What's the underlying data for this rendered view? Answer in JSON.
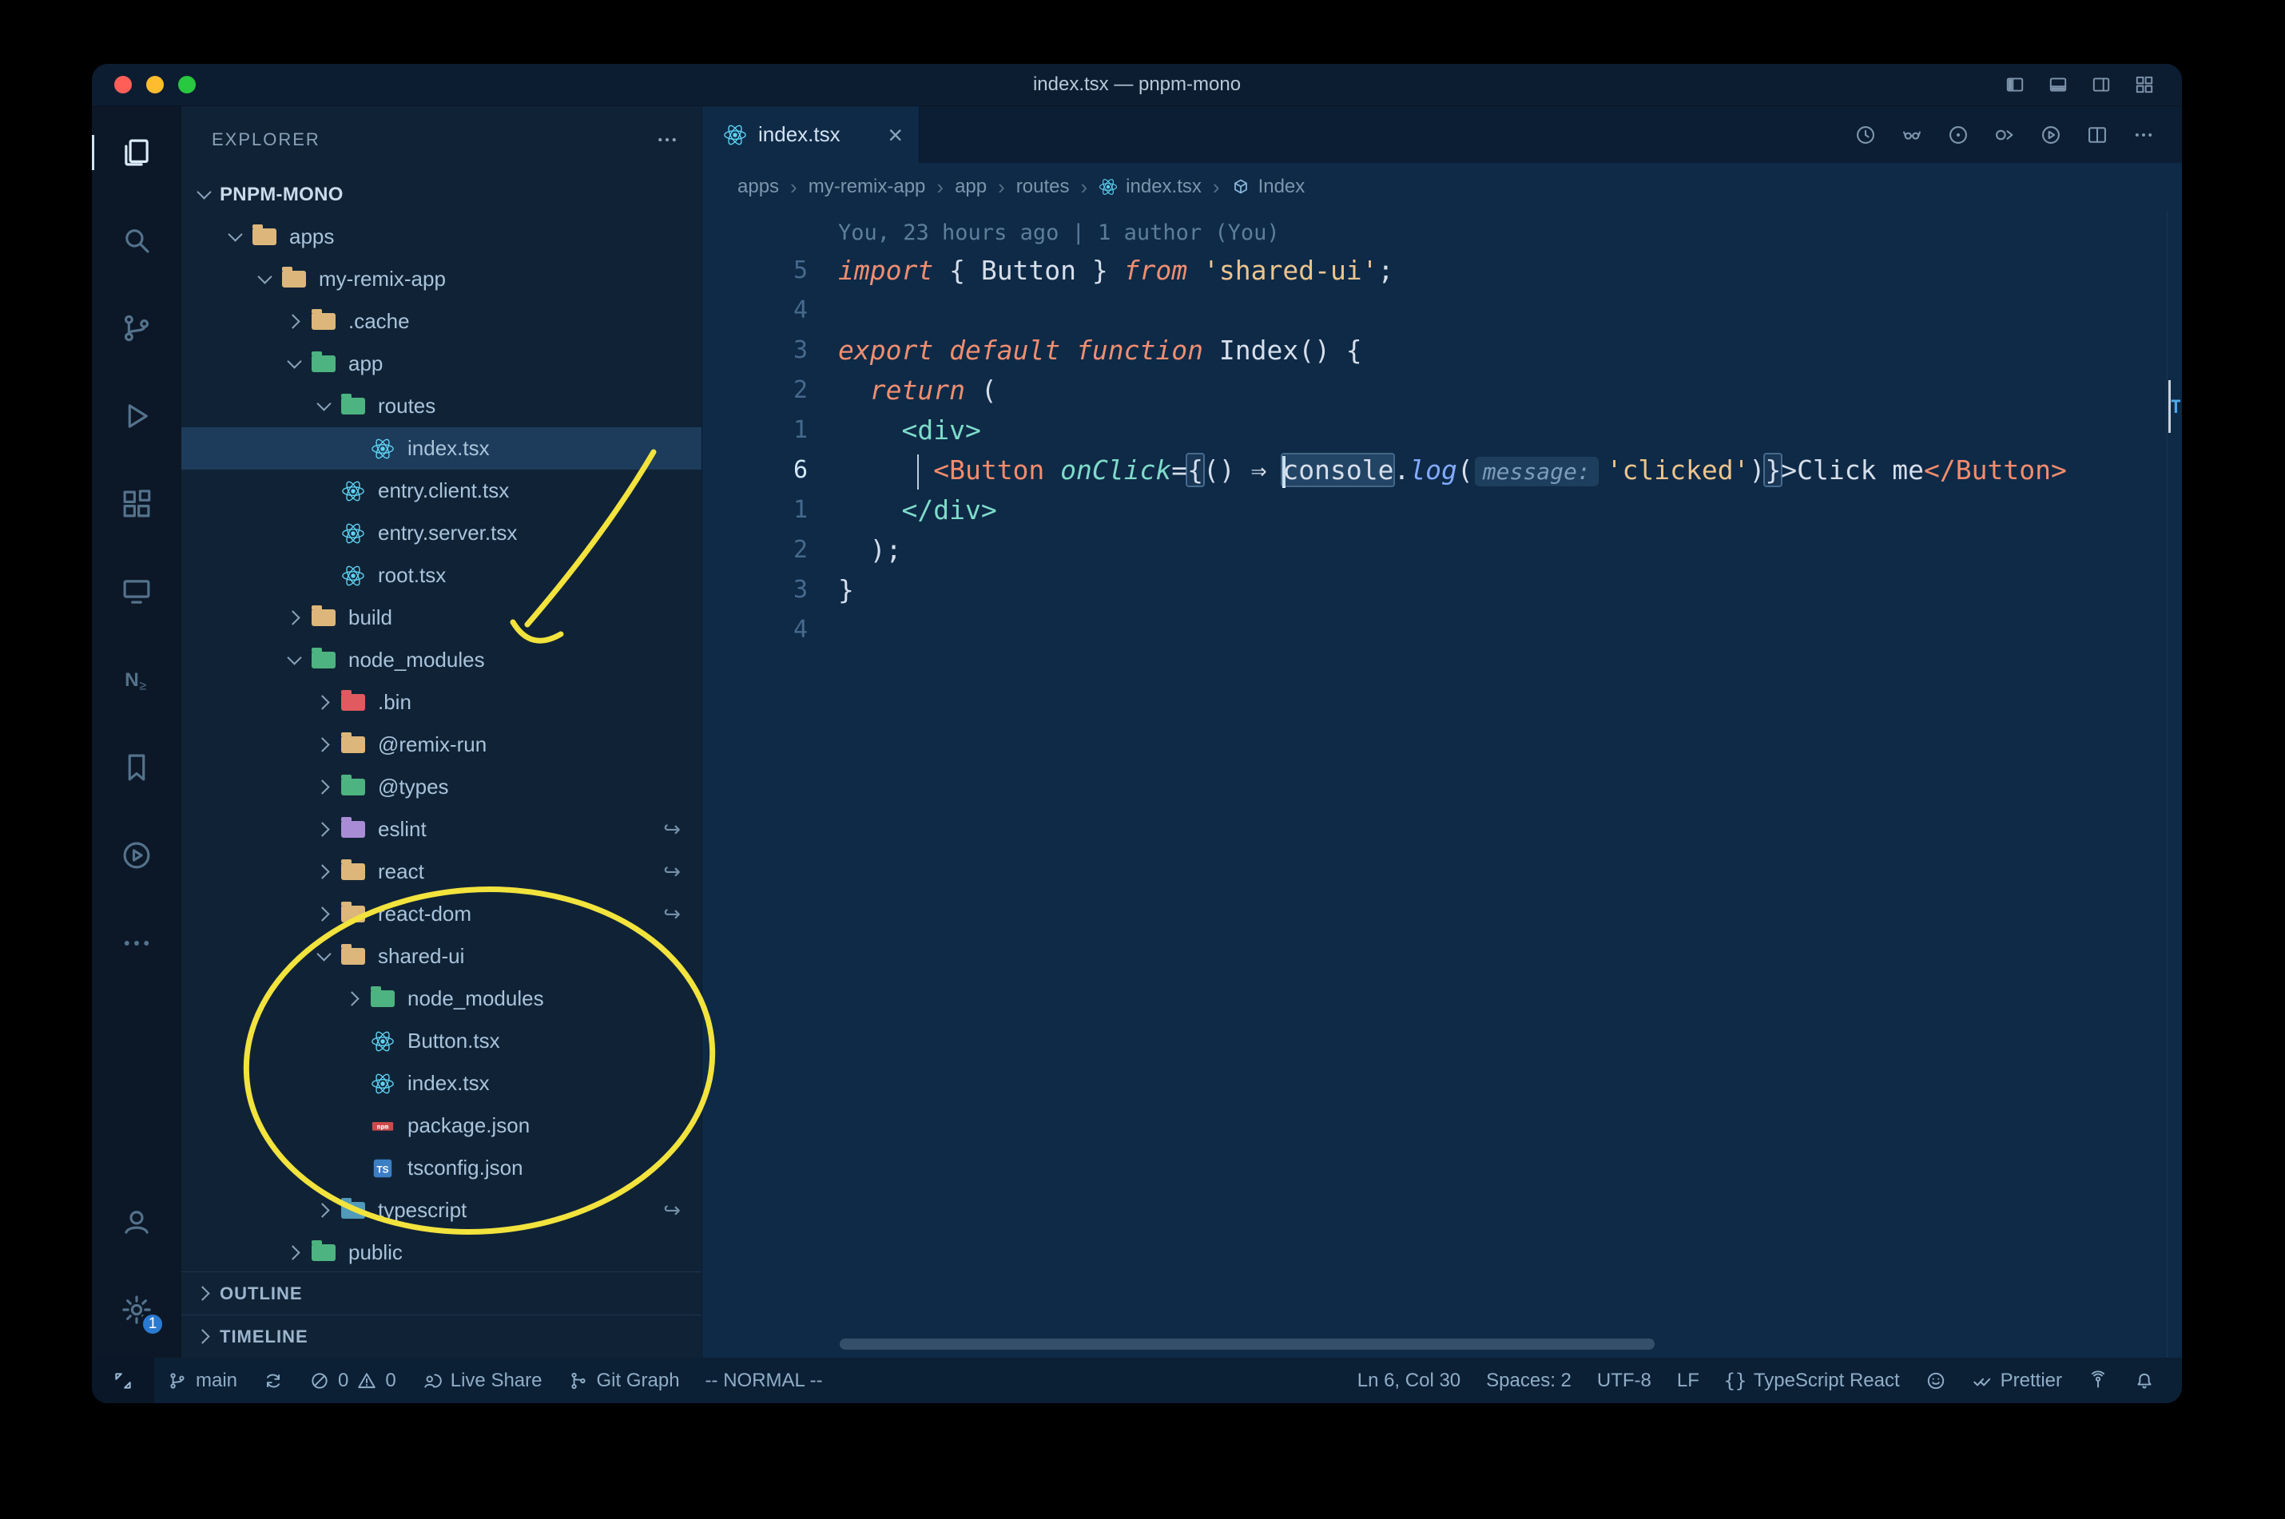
{
  "colors": {
    "annotation": "#f2e33d",
    "traffic_close": "#ff5f57",
    "traffic_minimize": "#febc2e",
    "traffic_zoom": "#28c840",
    "badge": "#2a7ad1"
  },
  "window": {
    "title": "index.tsx — pnpm-mono"
  },
  "titlebar": {
    "layout_icons": [
      "layout-sidebar-left-icon",
      "layout-panel-icon",
      "layout-sidebar-right-icon",
      "customize-layout-icon"
    ]
  },
  "activity_bar": {
    "top": [
      {
        "name": "explorer",
        "icon": "files-icon",
        "active": true
      },
      {
        "name": "search",
        "icon": "search-icon"
      },
      {
        "name": "source-control",
        "icon": "source-control-icon"
      },
      {
        "name": "run-debug",
        "icon": "run-debug-icon"
      },
      {
        "name": "extensions",
        "icon": "extensions-icon"
      },
      {
        "name": "remote-explorer",
        "icon": "remote-explorer-icon"
      },
      {
        "name": "nx-console",
        "icon": "nx-console-icon"
      },
      {
        "name": "bookmarks",
        "icon": "bookmarks-icon"
      },
      {
        "name": "code-runner",
        "icon": "code-runner-icon"
      },
      {
        "name": "additional-views",
        "icon": "ellipsis-icon"
      }
    ],
    "bottom": [
      {
        "name": "accounts",
        "icon": "accounts-icon"
      },
      {
        "name": "settings",
        "icon": "gear-icon",
        "badge": "1"
      }
    ]
  },
  "explorer": {
    "title": "EXPLORER",
    "root": "PNPM-MONO",
    "tree": [
      {
        "label": "apps",
        "depth": 1,
        "chevron": "down",
        "icon": "folder",
        "color": "#dcb67a"
      },
      {
        "label": "my-remix-app",
        "depth": 2,
        "chevron": "down",
        "icon": "folder",
        "color": "#dcb67a"
      },
      {
        "label": ".cache",
        "depth": 3,
        "chevron": "right",
        "icon": "folder",
        "color": "#dcb67a"
      },
      {
        "label": "app",
        "depth": 3,
        "chevron": "down",
        "icon": "folder",
        "color": "#4db380"
      },
      {
        "label": "routes",
        "depth": 4,
        "chevron": "down",
        "icon": "folder",
        "color": "#4db380"
      },
      {
        "label": "index.tsx",
        "depth": 5,
        "chevron": "none",
        "icon": "react",
        "selected": true
      },
      {
        "label": "entry.client.tsx",
        "depth": 4,
        "chevron": "none",
        "icon": "react"
      },
      {
        "label": "entry.server.tsx",
        "depth": 4,
        "chevron": "none",
        "icon": "react"
      },
      {
        "label": "root.tsx",
        "depth": 4,
        "chevron": "none",
        "icon": "react"
      },
      {
        "label": "build",
        "depth": 3,
        "chevron": "right",
        "icon": "folder",
        "color": "#dcb67a"
      },
      {
        "label": "node_modules",
        "depth": 3,
        "chevron": "down",
        "icon": "folder",
        "color": "#4db380"
      },
      {
        "label": ".bin",
        "depth": 4,
        "chevron": "right",
        "icon": "folder",
        "color": "#e05a5f"
      },
      {
        "label": "@remix-run",
        "depth": 4,
        "chevron": "right",
        "icon": "folder",
        "color": "#dcb67a"
      },
      {
        "label": "@types",
        "depth": 4,
        "chevron": "right",
        "icon": "folder",
        "color": "#4db380"
      },
      {
        "label": "eslint",
        "depth": 4,
        "chevron": "right",
        "icon": "folder",
        "color": "#a98cd6",
        "symlink": true
      },
      {
        "label": "react",
        "depth": 4,
        "chevron": "right",
        "icon": "folder",
        "color": "#dcb67a",
        "symlink": true
      },
      {
        "label": "react-dom",
        "depth": 4,
        "chevron": "right",
        "icon": "folder",
        "color": "#dcb67a",
        "symlink": true
      },
      {
        "label": "shared-ui",
        "depth": 4,
        "chevron": "down",
        "icon": "folder",
        "color": "#dcb67a"
      },
      {
        "label": "node_modules",
        "depth": 5,
        "chevron": "right",
        "icon": "folder",
        "color": "#4db380"
      },
      {
        "label": "Button.tsx",
        "depth": 5,
        "chevron": "none",
        "icon": "react"
      },
      {
        "label": "index.tsx",
        "depth": 5,
        "chevron": "none",
        "icon": "react"
      },
      {
        "label": "package.json",
        "depth": 5,
        "chevron": "none",
        "icon": "npm"
      },
      {
        "label": "tsconfig.json",
        "depth": 5,
        "chevron": "none",
        "icon": "ts"
      },
      {
        "label": "typescript",
        "depth": 4,
        "chevron": "right",
        "icon": "folder",
        "color": "#519aba",
        "symlink": true
      },
      {
        "label": "public",
        "depth": 3,
        "chevron": "right",
        "icon": "folder",
        "color": "#4db380"
      }
    ],
    "sections": [
      {
        "label": "OUTLINE"
      },
      {
        "label": "TIMELINE"
      }
    ]
  },
  "tab": {
    "label": "index.tsx",
    "icon": "react-icon",
    "close": "×"
  },
  "editor_actions": [
    "history-icon",
    "toggle-blame-icon",
    "compare-changes-icon",
    "open-changes-icon",
    "run-file-icon",
    "split-editor-icon",
    "more-actions-icon"
  ],
  "breadcrumbs": {
    "separator": "›",
    "items": [
      {
        "label": "apps"
      },
      {
        "label": "my-remix-app"
      },
      {
        "label": "app"
      },
      {
        "label": "routes"
      },
      {
        "label": "index.tsx",
        "icon": "react-icon"
      },
      {
        "label": "Index",
        "icon": "symbol-module-icon"
      }
    ]
  },
  "editor": {
    "blame": "You, 23 hours ago | 1 author (You)",
    "overview_marker": "T",
    "lines": [
      {
        "num": "5",
        "tokens": [
          {
            "t": "import",
            "c": "kw"
          },
          {
            "t": " { Button } ",
            "c": "pn"
          },
          {
            "t": "from",
            "c": "kw"
          },
          {
            "t": " ",
            "c": "pn"
          },
          {
            "t": "'shared-ui'",
            "c": "str"
          },
          {
            "t": ";",
            "c": "pn"
          }
        ]
      },
      {
        "num": "4",
        "tokens": []
      },
      {
        "num": "3",
        "tokens": [
          {
            "t": "export",
            "c": "kw"
          },
          {
            "t": " ",
            "c": "pn"
          },
          {
            "t": "default",
            "c": "kw"
          },
          {
            "t": " ",
            "c": "pn"
          },
          {
            "t": "function",
            "c": "kw"
          },
          {
            "t": " Index() {",
            "c": "pn"
          }
        ]
      },
      {
        "num": "2",
        "tokens": [
          {
            "t": "  ",
            "c": "pn"
          },
          {
            "t": "return",
            "c": "kw"
          },
          {
            "t": " (",
            "c": "pn"
          }
        ]
      },
      {
        "num": "1",
        "tokens": [
          {
            "t": "    ",
            "c": "pn"
          },
          {
            "t": "<div>",
            "c": "tag"
          }
        ]
      },
      {
        "num": "6",
        "current": true,
        "tokens": [
          {
            "t": "     ",
            "c": "pn"
          },
          {
            "t": "",
            "c": "iguide"
          },
          {
            "t": " ",
            "c": "pn"
          },
          {
            "t": "<Button",
            "c": "comp"
          },
          {
            "t": " ",
            "c": "pn"
          },
          {
            "t": "onClick",
            "c": "attr"
          },
          {
            "t": "=",
            "c": "pn"
          },
          {
            "t": "{",
            "c": "brhl"
          },
          {
            "t": "() ",
            "c": "pn"
          },
          {
            "t": "⇒",
            "c": "pn"
          },
          {
            "t": " ",
            "c": "pn"
          },
          {
            "t": "",
            "c": "cursor"
          },
          {
            "t": "console",
            "c": "wordhl"
          },
          {
            "t": ".",
            "c": "pn"
          },
          {
            "t": "log",
            "c": "method"
          },
          {
            "t": "(",
            "c": "pn"
          },
          {
            "t": "message:",
            "c": "inlay"
          },
          {
            "t": "'clicked'",
            "c": "str"
          },
          {
            "t": ")",
            "c": "pn"
          },
          {
            "t": "}",
            "c": "brhl"
          },
          {
            "t": ">",
            "c": "pn"
          },
          {
            "t": "Click me",
            "c": "pn"
          },
          {
            "t": "</Button>",
            "c": "comp"
          }
        ]
      },
      {
        "num": "1",
        "tokens": [
          {
            "t": "    ",
            "c": "pn"
          },
          {
            "t": "</div>",
            "c": "tag"
          }
        ]
      },
      {
        "num": "2",
        "tokens": [
          {
            "t": "  );",
            "c": "pn"
          }
        ]
      },
      {
        "num": "3",
        "tokens": [
          {
            "t": "}",
            "c": "pn"
          }
        ]
      },
      {
        "num": "4",
        "tokens": []
      }
    ]
  },
  "status_bar": {
    "left": [
      {
        "name": "remote-indicator",
        "style": "remote",
        "parts": [
          {
            "icon": "remote-icon"
          }
        ]
      },
      {
        "name": "git-branch",
        "parts": [
          {
            "icon": "git-branch-icon"
          },
          {
            "text": "main"
          }
        ]
      },
      {
        "name": "sync",
        "parts": [
          {
            "icon": "sync-icon"
          }
        ]
      },
      {
        "name": "problems",
        "parts": [
          {
            "icon": "error-icon"
          },
          {
            "text": "0"
          },
          {
            "icon": "warning-icon"
          },
          {
            "text": "0"
          }
        ]
      },
      {
        "name": "live-share",
        "parts": [
          {
            "icon": "live-share-icon"
          },
          {
            "text": "Live Share"
          }
        ]
      },
      {
        "name": "git-graph",
        "parts": [
          {
            "icon": "git-graph-icon"
          },
          {
            "text": "Git Graph"
          }
        ]
      },
      {
        "name": "vim-mode",
        "parts": [
          {
            "text": "-- NORMAL --"
          }
        ]
      }
    ],
    "right": [
      {
        "name": "cursor-position",
        "parts": [
          {
            "text": "Ln 6, Col 30"
          }
        ]
      },
      {
        "name": "indentation",
        "parts": [
          {
            "text": "Spaces: 2"
          }
        ]
      },
      {
        "name": "encoding",
        "parts": [
          {
            "text": "UTF-8"
          }
        ]
      },
      {
        "name": "eol",
        "parts": [
          {
            "text": "LF"
          }
        ]
      },
      {
        "name": "language-mode",
        "parts": [
          {
            "icon": "braces-icon"
          },
          {
            "text": "TypeScript React"
          }
        ]
      },
      {
        "name": "feedback",
        "parts": [
          {
            "icon": "smiley-icon"
          }
        ]
      },
      {
        "name": "prettier",
        "parts": [
          {
            "icon": "double-check-icon"
          },
          {
            "text": "Prettier"
          }
        ]
      },
      {
        "name": "broadcast",
        "parts": [
          {
            "icon": "broadcast-icon"
          }
        ]
      },
      {
        "name": "notifications",
        "parts": [
          {
            "icon": "bell-icon"
          }
        ]
      }
    ]
  }
}
